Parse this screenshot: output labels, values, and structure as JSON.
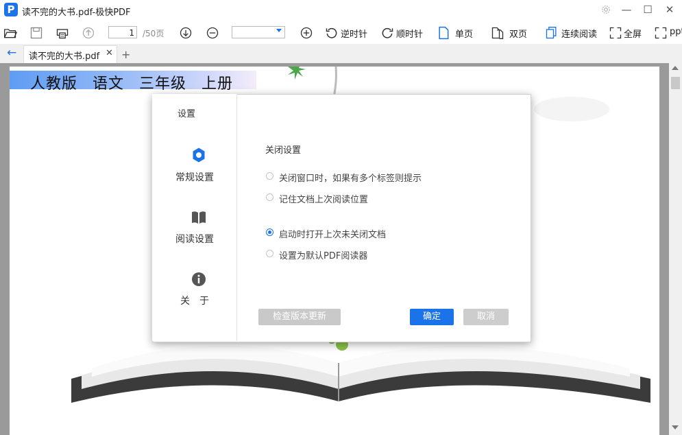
{
  "window": {
    "title": "读不完的大书.pdf-极快PDF",
    "logo_letter": "P",
    "controls": {
      "minimize": "—",
      "maximize": "☐",
      "close": "✕"
    }
  },
  "toolbar": {
    "page_current": "1",
    "page_total": "/50页",
    "zoom_value": "",
    "rotate_ccw": "逆时针",
    "rotate_cw": "顺时针",
    "single_page": "单页",
    "double_page": "双页",
    "continuous": "连续阅读",
    "fullscreen": "全屏",
    "ppt": "ppt"
  },
  "tabs": [
    {
      "label": "读不完的大书.pdf",
      "close": "✕"
    }
  ],
  "new_tab": "+",
  "document": {
    "banner": "人教版 语文 三年级 上册"
  },
  "dialog": {
    "title": "设置",
    "nav": [
      {
        "label": "常规设置",
        "icon": "gear-icon",
        "active": true
      },
      {
        "label": "阅读设置",
        "icon": "book-icon",
        "active": false
      },
      {
        "label": "关　于",
        "icon": "info-icon",
        "active": false
      }
    ],
    "section_title": "关闭设置",
    "options": [
      {
        "label": "关闭窗口时，如果有多个标签则提示",
        "checked": false
      },
      {
        "label": "记住文档上次阅读位置",
        "checked": false
      },
      {
        "label": "启动时打开上次未关闭文档",
        "checked": true
      },
      {
        "label": "设置为默认PDF阅读器",
        "checked": false
      }
    ],
    "buttons": {
      "check_update": "检查版本更新",
      "ok": "确定",
      "cancel": "取消"
    }
  },
  "colors": {
    "accent": "#1a73e8",
    "disabled_button": "#cdcdcd",
    "viewer_bg": "#9a9a9a"
  }
}
